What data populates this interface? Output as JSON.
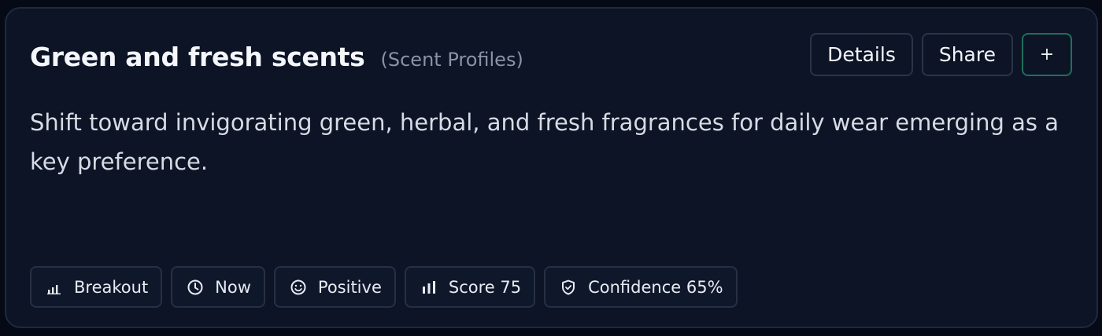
{
  "card": {
    "title": "Green and fresh scents",
    "category": "(Scent Profiles)",
    "description": "Shift toward invigorating green, herbal, and fresh fragrances for daily wear emerging as a key preference."
  },
  "actions": {
    "details_label": "Details",
    "share_label": "Share",
    "add_label": "+"
  },
  "chips": [
    {
      "icon": "bar-chart-icon",
      "label": "Breakout"
    },
    {
      "icon": "clock-icon",
      "label": "Now"
    },
    {
      "icon": "smiley-icon",
      "label": "Positive"
    },
    {
      "icon": "bar-chart-icon",
      "label": "Score 75"
    },
    {
      "icon": "shield-icon",
      "label": "Confidence 65%"
    }
  ],
  "colors": {
    "background": "#050a16",
    "card": "#0c1426",
    "accent_border": "#1f6f5a"
  }
}
